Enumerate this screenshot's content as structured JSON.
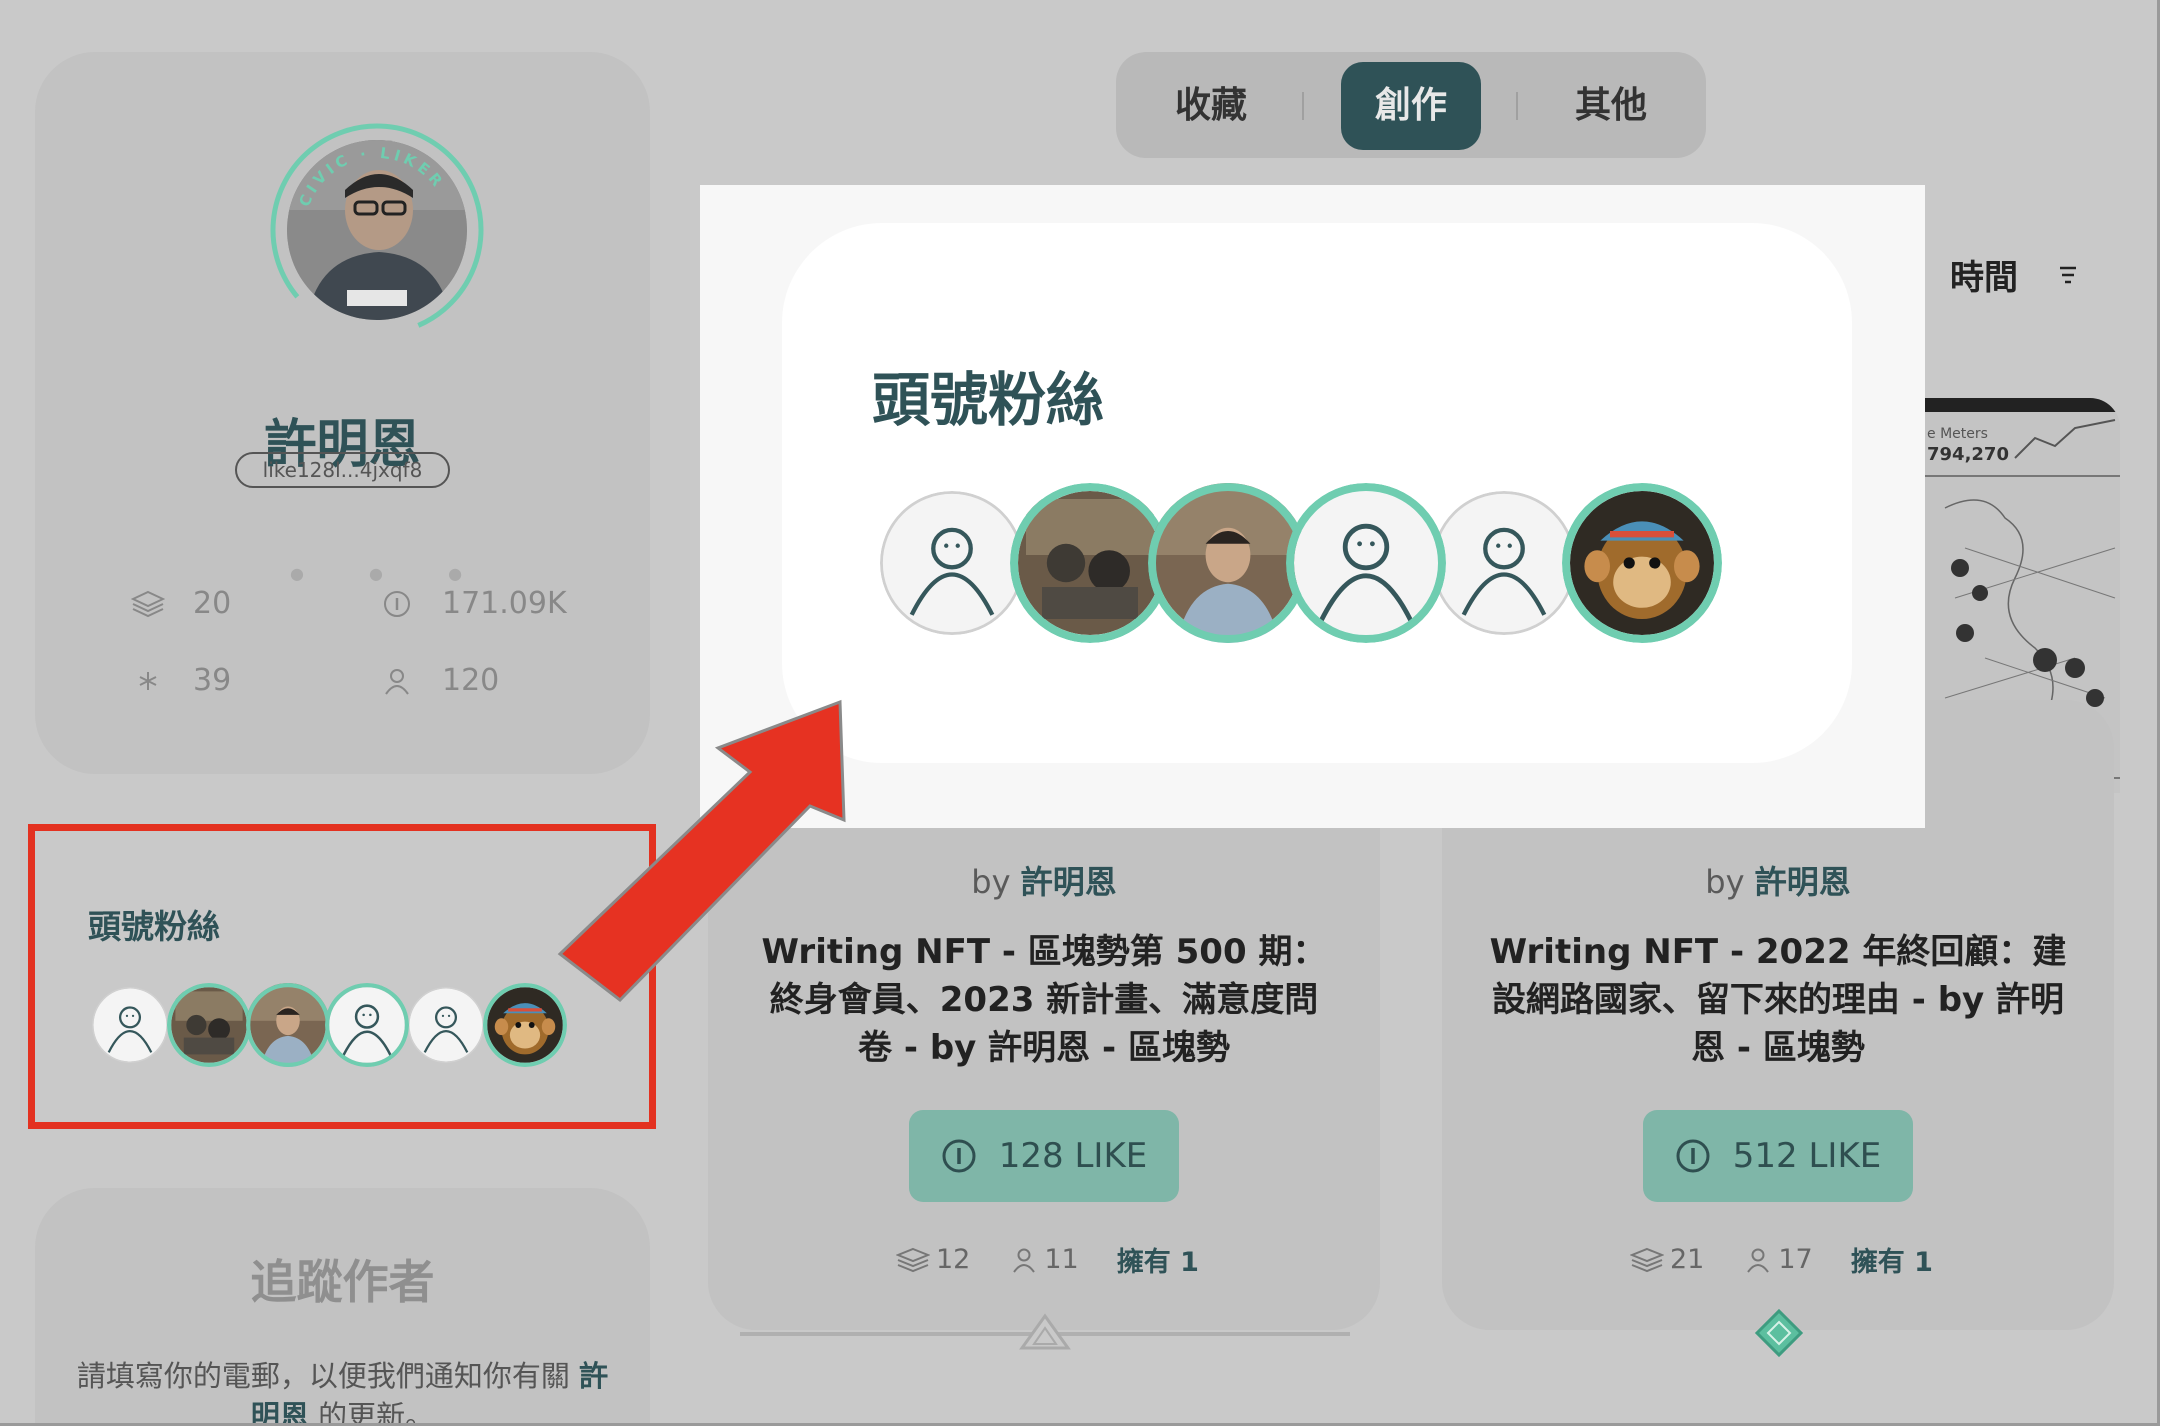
{
  "tabs": [
    {
      "label": "收藏",
      "active": false
    },
    {
      "label": "創作",
      "active": true
    },
    {
      "label": "其他",
      "active": false
    }
  ],
  "sort": {
    "label": "時間"
  },
  "profile": {
    "badge_text": "CIVIC · LIKER",
    "name": "許明恩",
    "address": "like128l...4jxqf8",
    "stats": {
      "works": "20",
      "likes": "171.09K",
      "sparkles": "39",
      "followers": "120"
    }
  },
  "top_fans": {
    "title": "頭號粉絲",
    "fans": [
      {
        "kind": "placeholder",
        "civic": false
      },
      {
        "kind": "photo-crowd",
        "civic": true
      },
      {
        "kind": "photo-man",
        "civic": true
      },
      {
        "kind": "placeholder",
        "civic": true
      },
      {
        "kind": "placeholder",
        "civic": false
      },
      {
        "kind": "monkey",
        "civic": true
      }
    ]
  },
  "follow": {
    "title": "追蹤作者",
    "text_before": "請填寫你的電郵，以便我們通知你有關",
    "author": "許明恩",
    "text_after": "的更新。"
  },
  "map_labels": {
    "meters": "e Meters",
    "value": "794,270"
  },
  "nfts": [
    {
      "by": "by",
      "author": "許明恩",
      "title": "Writing NFT - 區塊勢第 500 期：終身會員、2023 新計畫、滿意度問卷 - by 許明恩 - 區塊勢",
      "like": "128 LIKE",
      "collected": "12",
      "collectors": "11",
      "owned": "擁有 1"
    },
    {
      "by": "by",
      "author": "許明恩",
      "title": "Writing NFT - 2022 年終回顧：建設網路國家、留下來的理由 - by 許明恩 - 區塊勢",
      "like": "512 LIKE",
      "collected": "21",
      "collectors": "17",
      "owned": "擁有 1"
    }
  ],
  "colors": {
    "accent": "#2f5257",
    "civic_green": "#6fcdb0",
    "like_button": "#7fb6a8",
    "highlight": "#e33120"
  }
}
